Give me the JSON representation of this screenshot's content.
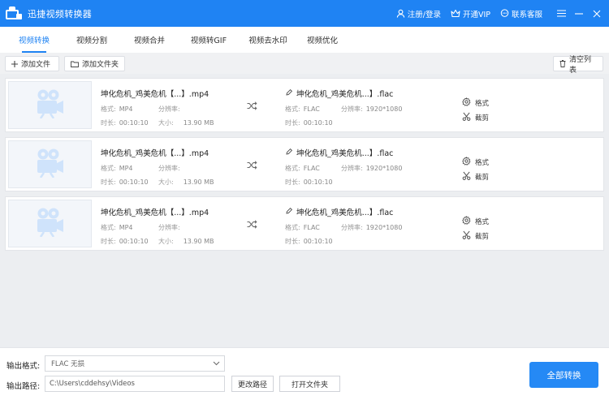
{
  "app": {
    "title": "迅捷视频转换器",
    "register_login": "注册/登录",
    "vip": "开通VIP",
    "support": "联系客服"
  },
  "tabs": [
    {
      "label": "视频转换",
      "active": true
    },
    {
      "label": "视频分割",
      "active": false
    },
    {
      "label": "视频合并",
      "active": false
    },
    {
      "label": "视频转GIF",
      "active": false
    },
    {
      "label": "视频去水印",
      "active": false
    },
    {
      "label": "视频优化",
      "active": false
    }
  ],
  "toolbar": {
    "add_file": "添加文件",
    "add_folder": "添加文件夹",
    "clear_list": "清空列表"
  },
  "labels": {
    "format": "格式:",
    "resolution": "分辨率:",
    "duration": "时长:",
    "size": "大小:",
    "action_format": "格式",
    "action_cut": "截剪"
  },
  "files": [
    {
      "source": {
        "name": "坤化危机_鸡美危机【...】.mp4",
        "format": "MP4",
        "resolution": "",
        "duration": "00:10:10",
        "size": "13.90 MB"
      },
      "output": {
        "name": "坤化危机_鸡美危机...】.flac",
        "format": "FLAC",
        "resolution": "1920*1080",
        "duration": "00:10:10"
      }
    },
    {
      "source": {
        "name": "坤化危机_鸡美危机【...】.mp4",
        "format": "MP4",
        "resolution": "",
        "duration": "00:10:10",
        "size": "13.90 MB"
      },
      "output": {
        "name": "坤化危机_鸡美危机...】.flac",
        "format": "FLAC",
        "resolution": "1920*1080",
        "duration": "00:10:10"
      }
    },
    {
      "source": {
        "name": "坤化危机_鸡美危机【...】.mp4",
        "format": "MP4",
        "resolution": "",
        "duration": "00:10:10",
        "size": "13.90 MB"
      },
      "output": {
        "name": "坤化危机_鸡美危机...】.flac",
        "format": "FLAC",
        "resolution": "1920*1080",
        "duration": "00:10:10"
      }
    }
  ],
  "bottom": {
    "format_label": "输出格式:",
    "format_value": "FLAC  无损",
    "path_label": "输出路径:",
    "path_value": "C:\\Users\\cddehsy\\Videos",
    "change_path": "更改路径",
    "open_folder": "打开文件夹",
    "convert_all": "全部转换"
  },
  "colors": {
    "brand": "#1f83f3",
    "button": "#2589f5",
    "thumb_icon": "#cfe3fb"
  }
}
